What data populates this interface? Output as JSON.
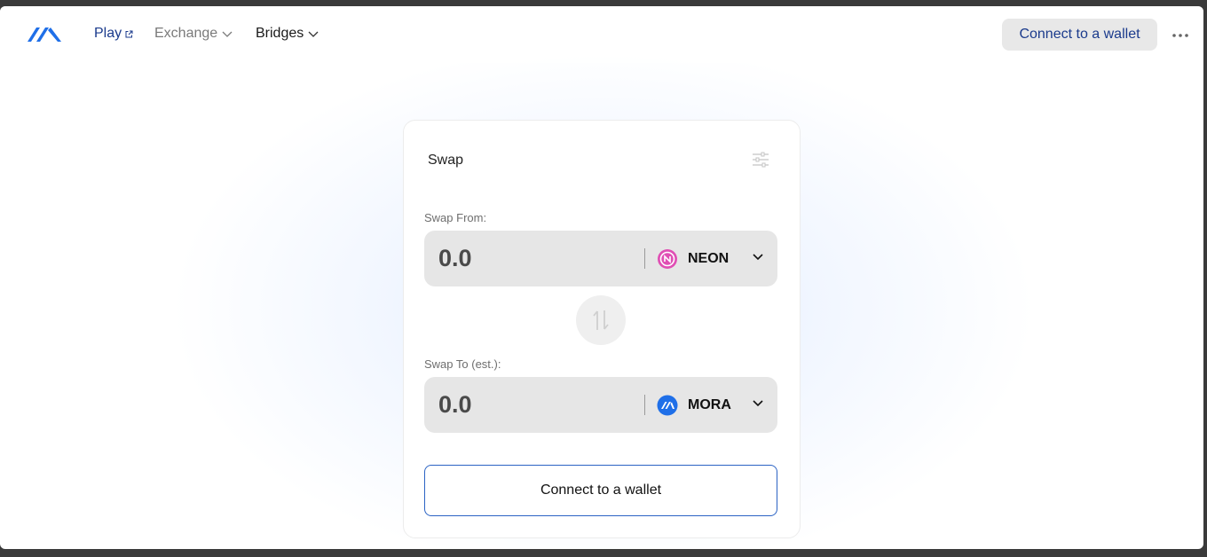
{
  "header": {
    "logo_icon": "mora-logo-icon",
    "nav": [
      {
        "label": "Play",
        "icon": "external-link-icon"
      },
      {
        "label": "Exchange",
        "icon": "chevron-down-icon"
      },
      {
        "label": "Bridges",
        "icon": "chevron-down-icon"
      }
    ],
    "connect_label": "Connect to a wallet",
    "more_icon": "more-horizontal-icon"
  },
  "swap": {
    "title": "Swap",
    "settings_icon": "sliders-icon",
    "from": {
      "label": "Swap From:",
      "amount_placeholder": "0.0",
      "token": "NEON",
      "token_icon": "neon-token-icon",
      "token_color": "#e04fb4"
    },
    "to": {
      "label": "Swap To (est.):",
      "amount_placeholder": "0.0",
      "token": "MORA",
      "token_icon": "mora-token-icon",
      "token_color": "#1f6fe8"
    },
    "switch_icon": "swap-arrows-icon",
    "connect_label": "Connect to a wallet"
  },
  "colors": {
    "accent": "#1a3a8c",
    "button_border": "#2b63c4",
    "field_bg": "#e6e6e6"
  }
}
